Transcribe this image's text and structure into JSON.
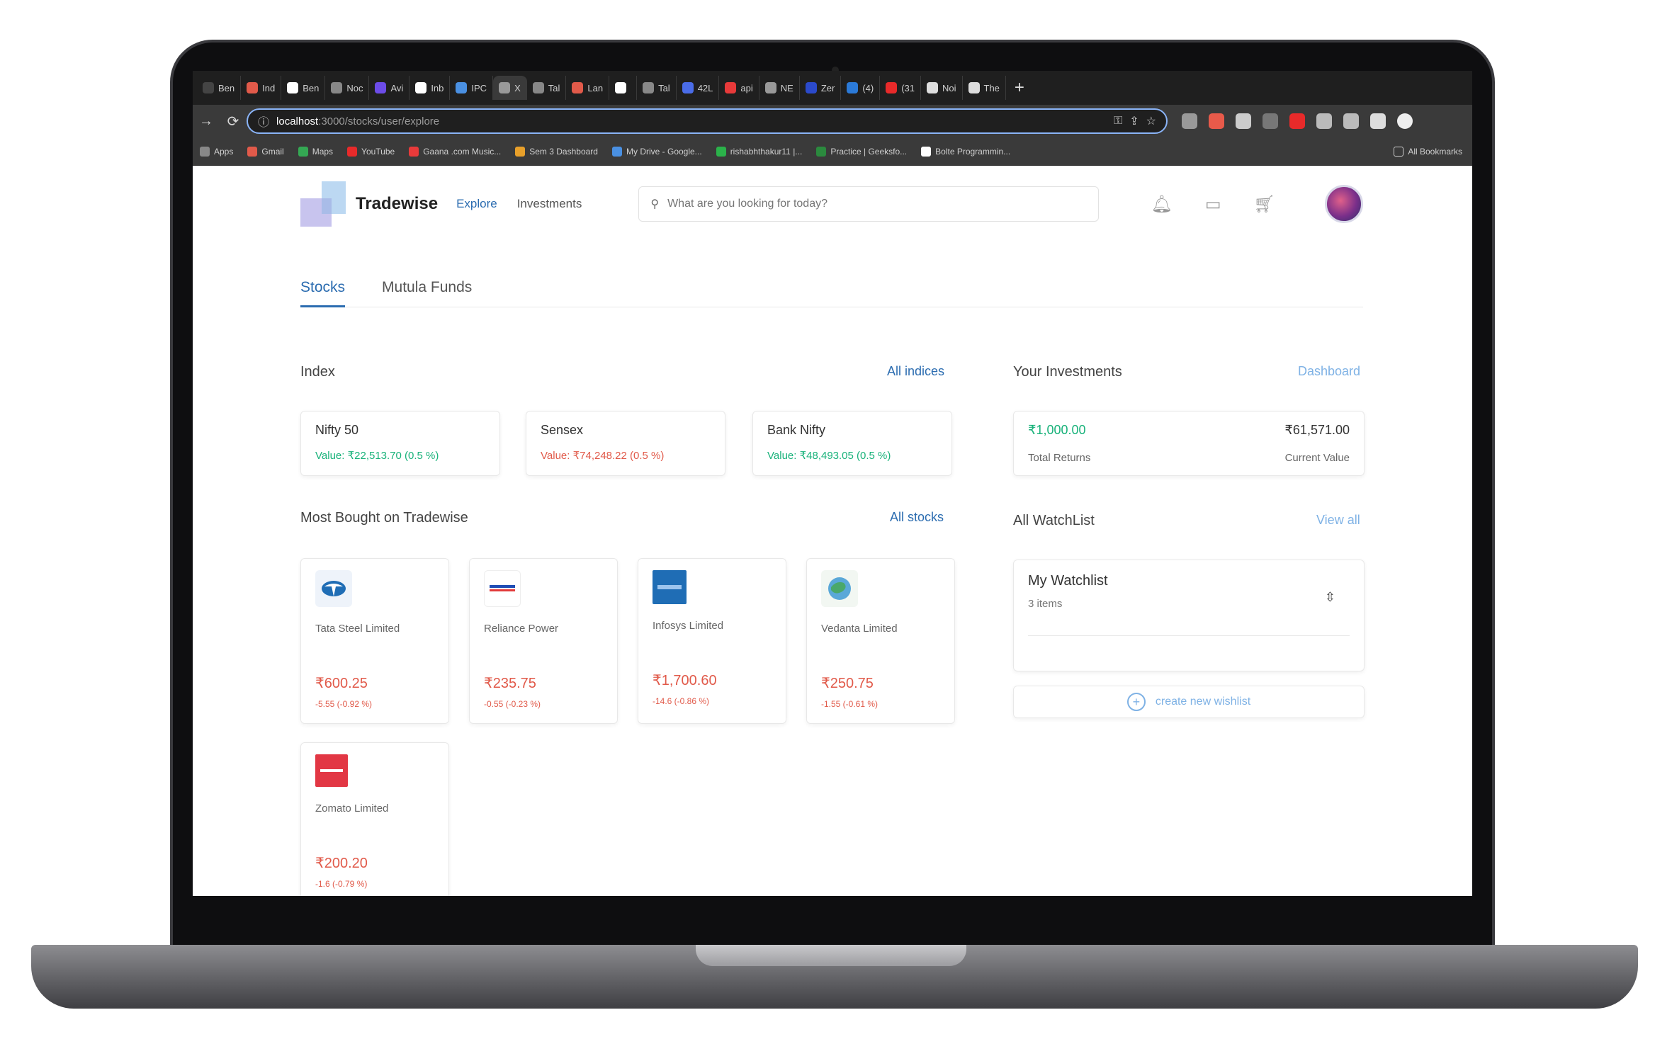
{
  "browser": {
    "tabs": [
      {
        "label": "Ben",
        "color": "#444"
      },
      {
        "label": "Ind",
        "color": "#e15a4a"
      },
      {
        "label": "Ben",
        "color": "#ffffff"
      },
      {
        "label": "Noc",
        "color": "#888"
      },
      {
        "label": "Avi",
        "color": "#6c4ce8"
      },
      {
        "label": "Inb",
        "color": "#ffffff"
      },
      {
        "label": "IPC",
        "color": "#4a90e2"
      },
      {
        "label": "X",
        "color": "#999",
        "active": true
      },
      {
        "label": "Tal",
        "color": "#888"
      },
      {
        "label": "Lan",
        "color": "#e15a4a"
      },
      {
        "label": "",
        "color": "#ffffff"
      },
      {
        "label": "Tal",
        "color": "#888"
      },
      {
        "label": "42L",
        "color": "#4a6ce8"
      },
      {
        "label": "api",
        "color": "#e83a3a"
      },
      {
        "label": "NE",
        "color": "#999"
      },
      {
        "label": "Zer",
        "color": "#2b4acb"
      },
      {
        "label": "(4)",
        "color": "#2b7ad8"
      },
      {
        "label": "(31",
        "color": "#e82a2a"
      },
      {
        "label": "Noi",
        "color": "#ddd"
      },
      {
        "label": "The",
        "color": "#ddd"
      }
    ],
    "newtab": "+",
    "url_host": "localhost",
    "url_path": ":3000/stocks/user/explore",
    "bookmarks": [
      {
        "label": "Apps",
        "color": "#888"
      },
      {
        "label": "Gmail",
        "color": "#e15a4a"
      },
      {
        "label": "Maps",
        "color": "#34a853"
      },
      {
        "label": "YouTube",
        "color": "#e82a2a"
      },
      {
        "label": "Gaana .com Music...",
        "color": "#e83a3a"
      },
      {
        "label": "Sem 3 Dashboard",
        "color": "#e8a02a"
      },
      {
        "label": "My Drive - Google...",
        "color": "#4a90e2"
      },
      {
        "label": "rishabhthakur11 |...",
        "color": "#2bb24a"
      },
      {
        "label": "Practice | Geeksfo...",
        "color": "#2b8a3e"
      },
      {
        "label": "Bolte Programmin...",
        "color": "#ffffff"
      }
    ],
    "bookmarks_right": "All Bookmarks"
  },
  "nav": {
    "brand": "Tradewise",
    "links": [
      "Explore",
      "Investments"
    ],
    "search_placeholder": "What are you looking for today?"
  },
  "page_tabs": [
    "Stocks",
    "Mutula Funds"
  ],
  "index_section": {
    "title": "Index",
    "link": "All indices",
    "cards": [
      {
        "name": "Nifty 50",
        "value": "Value: ₹22,513.70 (0.5 %)",
        "trend": "up"
      },
      {
        "name": "Sensex",
        "value": "Value: ₹74,248.22 (0.5 %)",
        "trend": "down"
      },
      {
        "name": "Bank Nifty",
        "value": "Value: ₹48,493.05 (0.5 %)",
        "trend": "up"
      }
    ]
  },
  "investments": {
    "title": "Your Investments",
    "link": "Dashboard",
    "total_returns_value": "₹1,000.00",
    "total_returns_label": "Total Returns",
    "current_value": "₹61,571.00",
    "current_value_label": "Current Value"
  },
  "most_bought": {
    "title": "Most Bought on Tradewise",
    "link": "All stocks",
    "stocks": [
      {
        "name": "Tata Steel Limited",
        "price": "₹600.25",
        "change": "-5.55 (-0.92 %)",
        "logo_color": "#1f6db5",
        "logo_icon": "tata-logo-icon"
      },
      {
        "name": "Reliance Power",
        "price": "₹235.75",
        "change": "-0.55 (-0.23 %)",
        "logo_color": "#ffffff",
        "logo_icon": "reliance-logo-icon"
      },
      {
        "name": "Infosys Limited",
        "price": "₹1,700.60",
        "change": "-14.6 (-0.86 %)",
        "logo_color": "#1f6db5",
        "logo_icon": "infosys-logo-icon"
      },
      {
        "name": "Vedanta Limited",
        "price": "₹250.75",
        "change": "-1.55 (-0.61 %)",
        "logo_color": "#4aa86a",
        "logo_icon": "vedanta-logo-icon"
      },
      {
        "name": "Zomato Limited",
        "price": "₹200.20",
        "change": "-1.6 (-0.79 %)",
        "logo_color": "#e23744",
        "logo_icon": "zomato-logo-icon"
      }
    ]
  },
  "watchlist": {
    "title": "All WatchList",
    "link": "View all",
    "list_name": "My Watchlist",
    "list_count": "3 items",
    "create_label": "create new wishlist"
  },
  "colors": {
    "accent": "#2b6cb0",
    "positive": "#18b27a",
    "negative": "#e15a4a"
  }
}
